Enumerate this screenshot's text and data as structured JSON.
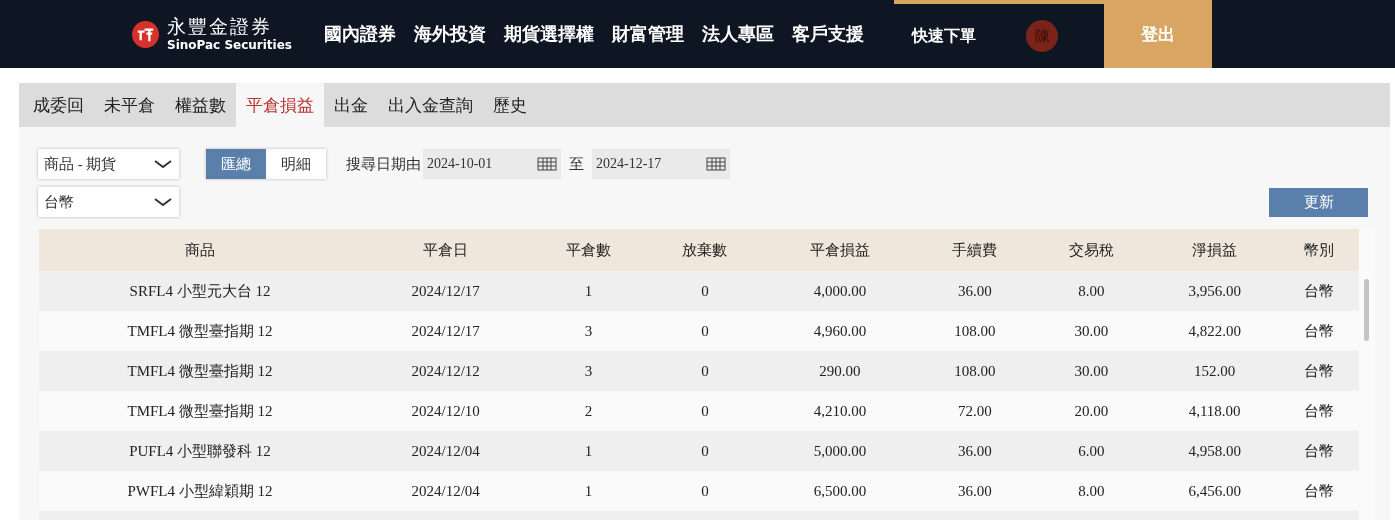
{
  "header": {
    "brand_name": "永豐金證券",
    "brand_sub": "SinoPac Securities",
    "nav": [
      "國內證券",
      "海外投資",
      "期貨選擇權",
      "財富管理",
      "法人專區",
      "客戶支援"
    ],
    "quick_order": "快速下單",
    "avatar": "陳",
    "logout": "登出"
  },
  "tabs": [
    {
      "label": "成委回",
      "selected": false
    },
    {
      "label": "未平倉",
      "selected": false
    },
    {
      "label": "權益數",
      "selected": false
    },
    {
      "label": "平倉損益",
      "selected": true
    },
    {
      "label": "出金",
      "selected": false
    },
    {
      "label": "出入金查詢",
      "selected": false
    },
    {
      "label": "歷史",
      "selected": false
    }
  ],
  "filters": {
    "product": "商品 - 期貨",
    "currency": "台幣",
    "modes": [
      {
        "label": "匯總",
        "selected": true
      },
      {
        "label": "明細",
        "selected": false
      }
    ],
    "date_label": "搜尋日期由",
    "date_from": "2024-10-01",
    "date_sep": "至",
    "date_to": "2024-12-17",
    "refresh": "更新"
  },
  "table": {
    "columns": [
      "商品",
      "平倉日",
      "平倉數",
      "放棄數",
      "平倉損益",
      "手續費",
      "交易稅",
      "淨損益",
      "幣別"
    ],
    "rows": [
      [
        "SRFL4 小型元大台 12",
        "2024/12/17",
        "1",
        "0",
        "4,000.00",
        "36.00",
        "8.00",
        "3,956.00",
        "台幣"
      ],
      [
        "TMFL4 微型臺指期 12",
        "2024/12/17",
        "3",
        "0",
        "4,960.00",
        "108.00",
        "30.00",
        "4,822.00",
        "台幣"
      ],
      [
        "TMFL4 微型臺指期 12",
        "2024/12/12",
        "3",
        "0",
        "290.00",
        "108.00",
        "30.00",
        "152.00",
        "台幣"
      ],
      [
        "TMFL4 微型臺指期 12",
        "2024/12/10",
        "2",
        "0",
        "4,210.00",
        "72.00",
        "20.00",
        "4,118.00",
        "台幣"
      ],
      [
        "PUFL4 小型聯發科 12",
        "2024/12/04",
        "1",
        "0",
        "5,000.00",
        "36.00",
        "6.00",
        "4,958.00",
        "台幣"
      ],
      [
        "PWFL4 小型緯穎期 12",
        "2024/12/04",
        "1",
        "0",
        "6,500.00",
        "36.00",
        "8.00",
        "6,456.00",
        "台幣"
      ]
    ]
  }
}
